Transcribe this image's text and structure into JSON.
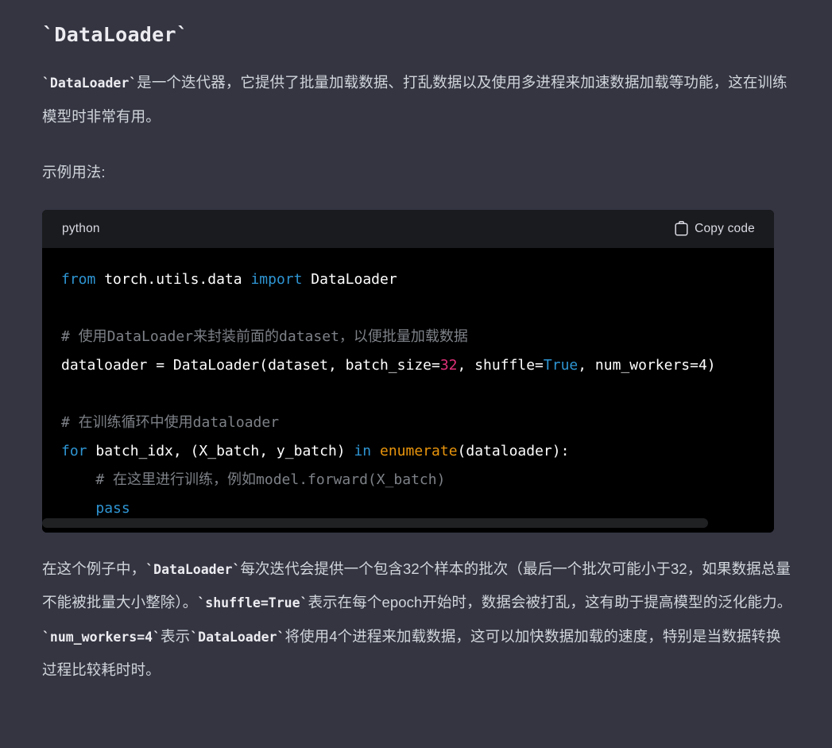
{
  "heading": "`DataLoader`",
  "intro_paragraph": {
    "code_prefix": "`DataLoader`",
    "text": "是一个迭代器，它提供了批量加载数据、打乱数据以及使用多进程来加速数据加载等功能，这在训练模型时非常有用。"
  },
  "example_label": "示例用法:",
  "code_block": {
    "language": "python",
    "copy_label": "Copy code",
    "copy_icon": "clipboard-icon",
    "scrollbar": {
      "orientation": "horizontal",
      "thumb_fraction": 0.91
    },
    "lines": [
      {
        "tokens": [
          {
            "t": "from",
            "c": "kw"
          },
          {
            "t": " torch.utils.data ",
            "c": "plain"
          },
          {
            "t": "import",
            "c": "kw"
          },
          {
            "t": " DataLoader",
            "c": "plain"
          }
        ]
      },
      {
        "tokens": []
      },
      {
        "tokens": [
          {
            "t": "# 使用DataLoader来封装前面的dataset，以便批量加载数据",
            "c": "cmt"
          }
        ]
      },
      {
        "tokens": [
          {
            "t": "dataloader = DataLoader(dataset, batch_size=",
            "c": "plain"
          },
          {
            "t": "32",
            "c": "num"
          },
          {
            "t": ", shuffle=",
            "c": "plain"
          },
          {
            "t": "True",
            "c": "kw"
          },
          {
            "t": ", num_workers=4)",
            "c": "plain"
          }
        ]
      },
      {
        "tokens": []
      },
      {
        "tokens": [
          {
            "t": "# 在训练循环中使用dataloader",
            "c": "cmt"
          }
        ]
      },
      {
        "tokens": [
          {
            "t": "for",
            "c": "kw"
          },
          {
            "t": " batch_idx, (X_batch, y_batch) ",
            "c": "plain"
          },
          {
            "t": "in",
            "c": "kw"
          },
          {
            "t": " ",
            "c": "plain"
          },
          {
            "t": "enumerate",
            "c": "fn"
          },
          {
            "t": "(dataloader):",
            "c": "plain"
          }
        ]
      },
      {
        "tokens": [
          {
            "t": "    # 在这里进行训练，例如model.forward(X_batch)",
            "c": "cmt"
          }
        ]
      },
      {
        "tokens": [
          {
            "t": "    ",
            "c": "plain"
          },
          {
            "t": "pass",
            "c": "kw"
          }
        ]
      }
    ]
  },
  "tail_paragraph": {
    "seg1": "在这个例子中，",
    "code1": "`DataLoader`",
    "seg2": "每次迭代会提供一个包含32个样本的批次（最后一个批次可能小于32，如果数据总量不能被批量大小整除）。",
    "code2": "`shuffle=True`",
    "seg3": "表示在每个epoch开始时，数据会被打乱，这有助于提高模型的泛化能力。",
    "code3": "`num_workers=4`",
    "seg4": "表示",
    "code4": "`DataLoader`",
    "seg5": "将使用4个进程来加载数据，这可以加快数据加载的速度，特别是当数据转换过程比较耗时时。"
  },
  "colors": {
    "page_background": "#343541",
    "code_background": "#000000",
    "code_header_background": "#1a1b1e",
    "text": "#d1d5db",
    "keyword": "#2e95d3",
    "number": "#df3079",
    "function": "#e9950c",
    "comment": "#7d8187",
    "scrollbar_thumb": "#202123"
  }
}
